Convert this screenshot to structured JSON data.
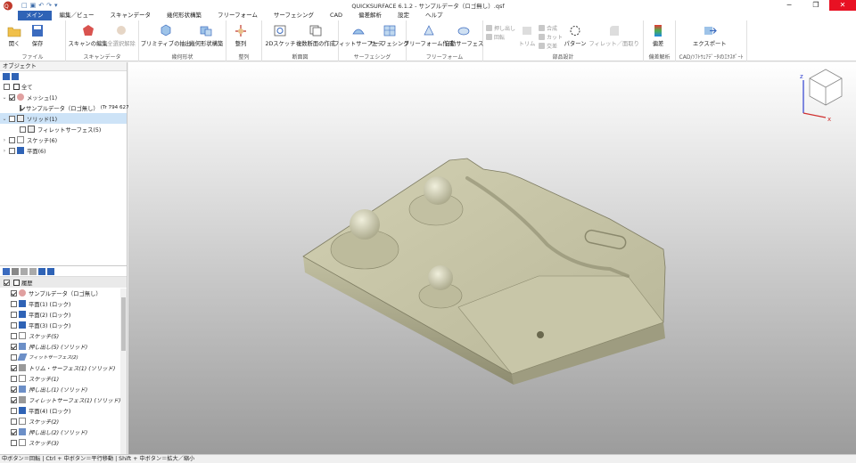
{
  "window": {
    "title": "QUICKSURFACE 6.1.2 - サンプルデータ（ロゴ無し）.qsf",
    "controls": [
      "─",
      "❐",
      "✕"
    ]
  },
  "tabs": [
    "メイン",
    "編集／ビュー",
    "スキャンデータ",
    "幾何形状構築",
    "フリーフォーム",
    "サーフェシング",
    "CAD",
    "偏差解析",
    "設定",
    "ヘルプ"
  ],
  "ribbon": {
    "groups": [
      {
        "name": "ファイル",
        "buttons": [
          {
            "label": "開く"
          },
          {
            "label": "保存"
          }
        ]
      },
      {
        "name": "スキャンデータ",
        "buttons": [
          {
            "label": "スキャンの編集"
          },
          {
            "label": "全選択解除"
          }
        ]
      },
      {
        "name": "幾何形状",
        "buttons": [
          {
            "label": "プリミティブの抽出"
          },
          {
            "label": "幾何形状構築"
          }
        ]
      },
      {
        "name": "整列",
        "buttons": [
          {
            "label": "整列"
          }
        ]
      },
      {
        "name": "断面図",
        "buttons": [
          {
            "label": "2Dスケッチ"
          },
          {
            "label": "複数断面の作成"
          }
        ]
      },
      {
        "name": "サーフェシング",
        "buttons": [
          {
            "label": "フィットサーフェス"
          },
          {
            "label": "サーフェシング"
          }
        ]
      },
      {
        "name": "フリーフォーム",
        "buttons": [
          {
            "label": "フリーフォーム作成"
          },
          {
            "label": "自動サーフェス"
          }
        ]
      },
      {
        "name": "部品設計",
        "small": [
          "押し出し",
          "回転",
          "合成",
          "カット",
          "交差"
        ],
        "buttons": [
          {
            "label": "トリム"
          },
          {
            "label": "パターン"
          },
          {
            "label": "フィレット／面取り"
          }
        ]
      },
      {
        "name": "偏差解析",
        "buttons": [
          {
            "label": "偏差"
          }
        ]
      },
      {
        "name": "CAD/ｿﾌﾄｳｪｱﾃﾞｰﾀのｴｸｽﾎﾟｰﾄ",
        "buttons": [
          {
            "label": "エクスポート"
          }
        ]
      }
    ]
  },
  "objects": {
    "header": "オブジェクト",
    "items": [
      {
        "label": "全て",
        "level": 0,
        "checked": false
      },
      {
        "label": "メッシュ(1)",
        "level": 1,
        "checked": true
      },
      {
        "label": "サンプルデータ（ロゴ無し）",
        "extra": "(Tr 794 627)",
        "level": 2,
        "checked": true
      },
      {
        "label": "ソリッド(1)",
        "level": 1,
        "checked": false,
        "selected": true
      },
      {
        "label": "フィレットサーフェス(5)",
        "level": 2,
        "checked": false
      },
      {
        "label": "スケッチ(6)",
        "level": 1,
        "checked": false
      },
      {
        "label": "平面(6)",
        "level": 1,
        "checked": false
      }
    ]
  },
  "history": {
    "header": "履歴",
    "items": [
      {
        "label": "サンプルデータ（ロゴ無し）",
        "checked": true,
        "type": "mesh"
      },
      {
        "label": "平面(1) (ロック)",
        "checked": false,
        "type": "plane"
      },
      {
        "label": "平面(2) (ロック)",
        "checked": false,
        "type": "plane"
      },
      {
        "label": "平面(3) (ロック)",
        "checked": false,
        "type": "plane"
      },
      {
        "label": "スケッチ(5)",
        "checked": false,
        "type": "sketch"
      },
      {
        "label": "押し出し(5) (ソリッド)",
        "checked": true,
        "type": "extrude"
      },
      {
        "label": "フィットサーフェス(2)",
        "checked": false,
        "type": "surface"
      },
      {
        "label": "トリム・サーフェス(1) (ソリッド)",
        "checked": true,
        "type": "trim"
      },
      {
        "label": "スケッチ(1)",
        "checked": false,
        "type": "sketch"
      },
      {
        "label": "押し出し(1) (ソリッド)",
        "checked": true,
        "type": "extrude"
      },
      {
        "label": "フィレットサーフェス(1) (ソリッド)",
        "checked": true,
        "type": "trim"
      },
      {
        "label": "平面(4) (ロック)",
        "checked": false,
        "type": "plane"
      },
      {
        "label": "スケッチ(2)",
        "checked": false,
        "type": "sketch"
      },
      {
        "label": "押し出し(2) (ソリッド)",
        "checked": true,
        "type": "extrude"
      },
      {
        "label": "スケッチ(3)",
        "checked": false,
        "type": "sketch"
      }
    ]
  },
  "viewcube": {
    "z": "z",
    "x": "x"
  },
  "status": "中ボタン＝回転 | Ctrl + 中ボタン＝平行移動 | Shift + 中ボタン＝拡大／縮小"
}
